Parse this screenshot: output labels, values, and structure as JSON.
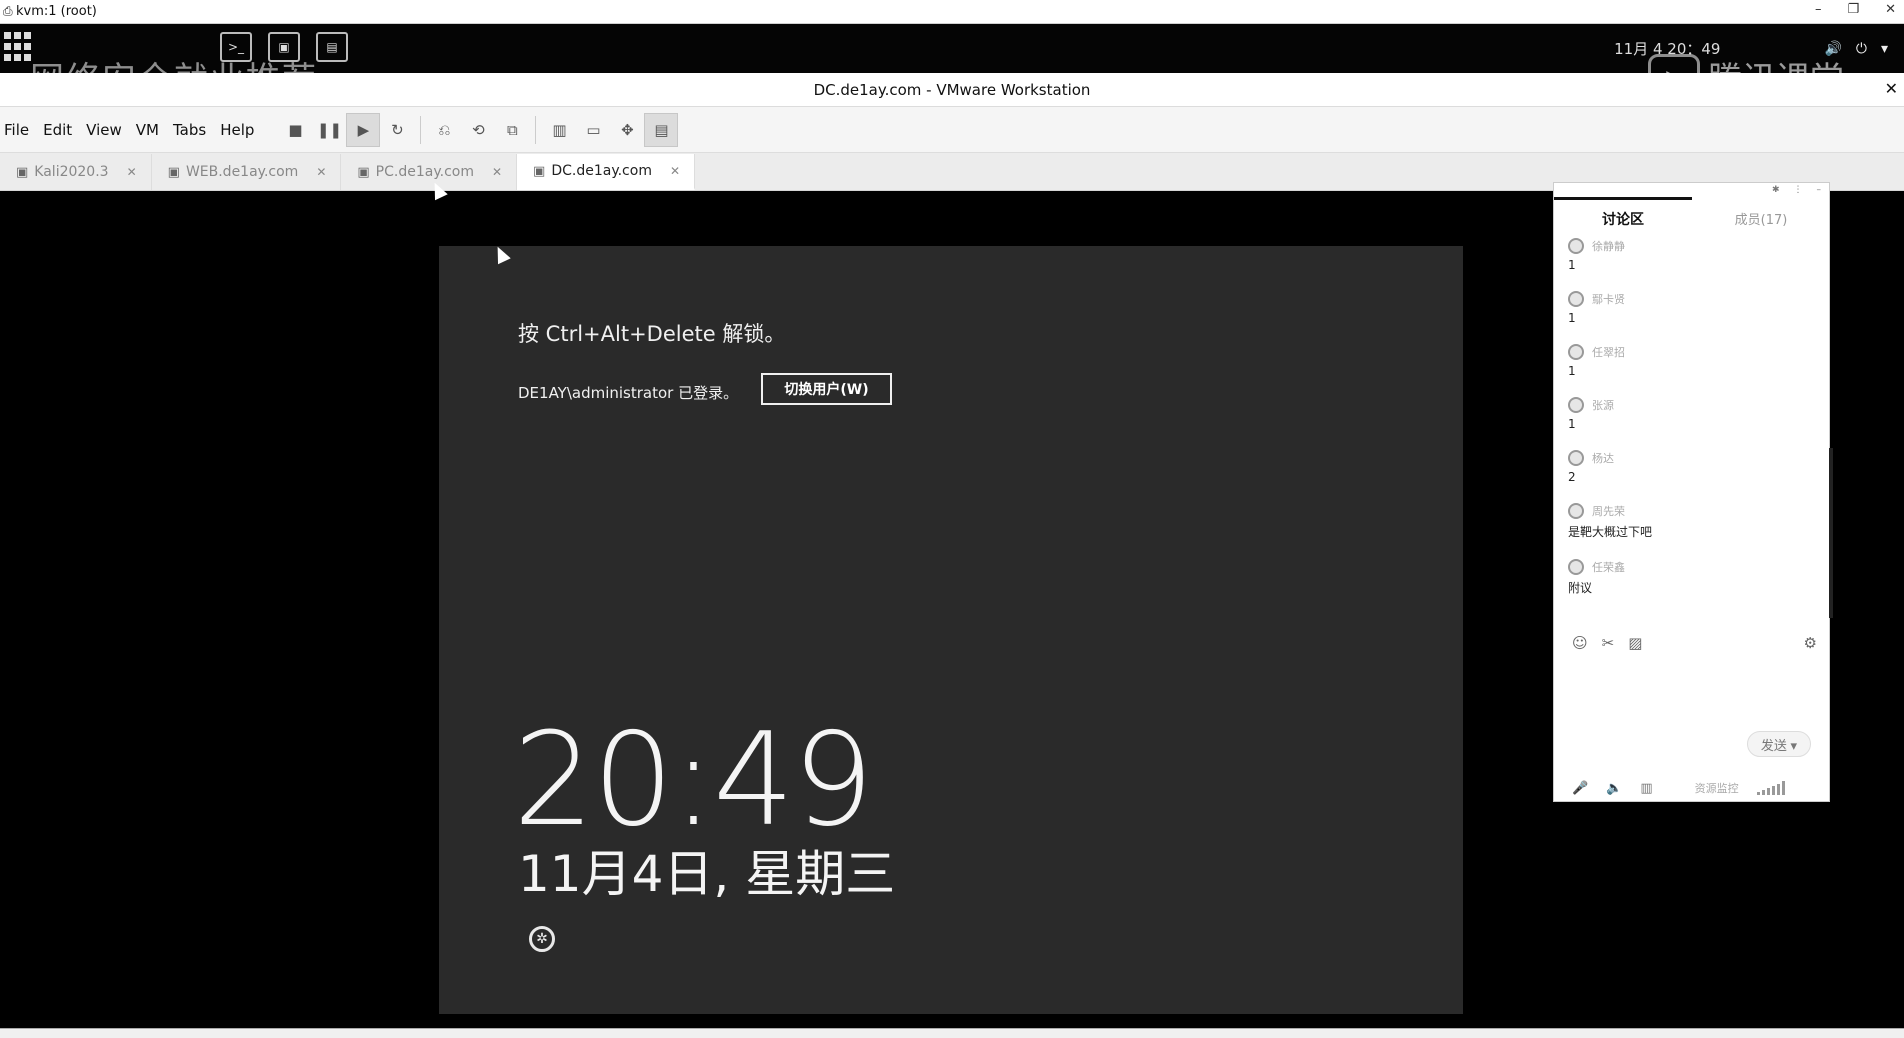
{
  "host": {
    "title": "kvm:1 (root)",
    "controls": [
      "–",
      "❐",
      "✕"
    ]
  },
  "kali_panel": {
    "watermark": "网络安全就业推荐",
    "clock": "11月 4 20：49",
    "brand": "腾讯课堂",
    "panel_icons": [
      ">_",
      "▣",
      "▤"
    ]
  },
  "vmware": {
    "title": "DC.de1ay.com - VMware Workstation",
    "menu": [
      "File",
      "Edit",
      "View",
      "VM",
      "Tabs",
      "Help"
    ],
    "tabs": [
      {
        "label": "Kali2020.3",
        "active": false
      },
      {
        "label": "WEB.de1ay.com",
        "active": false
      },
      {
        "label": "PC.de1ay.com",
        "active": false
      },
      {
        "label": "DC.de1ay.com",
        "active": true
      }
    ]
  },
  "lockscreen": {
    "hint": "按 Ctrl+Alt+Delete 解锁。",
    "logged_in": "DE1AY\\administrator 已登录。",
    "switch_user": "切换用户(W)",
    "time": "20:49",
    "date": "11月4日, 星期三"
  },
  "chat": {
    "tab_discuss": "讨论区",
    "tab_members": "成员(17)",
    "messages": [
      {
        "user": "徐静静",
        "text": "1"
      },
      {
        "user": "鄢卡贤",
        "text": "1"
      },
      {
        "user": "任翠招",
        "text": "1"
      },
      {
        "user": "张源",
        "text": "1"
      },
      {
        "user": "杨达",
        "text": "2"
      },
      {
        "user": "周先荣",
        "text": "是靶大概过下吧"
      },
      {
        "user": "任荣鑫",
        "text": "附议"
      }
    ],
    "send": "发送",
    "resource": "资源监控"
  }
}
